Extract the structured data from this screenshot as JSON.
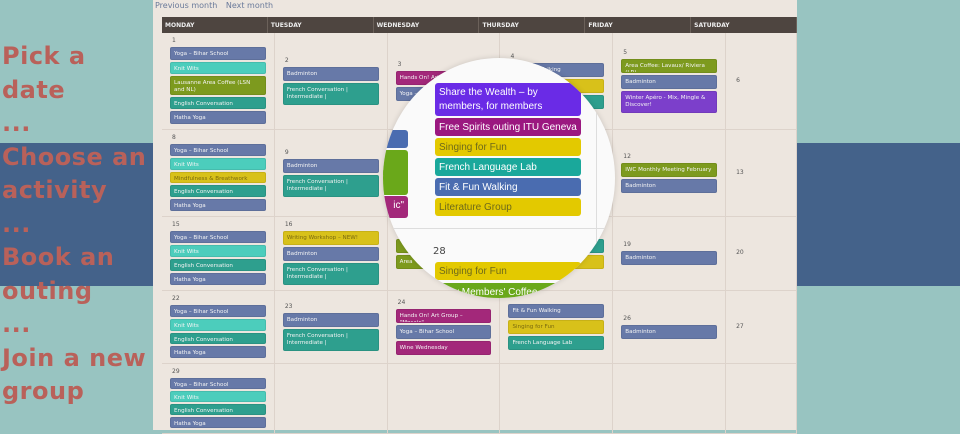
{
  "promo": {
    "lines": [
      "Pick a date",
      "...",
      "Choose an",
      "activity",
      "...",
      "Book an",
      "outing",
      "...",
      "Join a new",
      "group"
    ]
  },
  "nav": {
    "previous": "Previous month",
    "next": "Next month"
  },
  "colors": {
    "slate": "#6779a8",
    "aqua": "#4ccdbc",
    "olive": "#7d9a1e",
    "teal": "#2e9f8e",
    "magenta": "#a3287a",
    "yellow": "#d8c11a",
    "purple": "#7c3fcb",
    "violet": "#6a2be6",
    "plum": "#9b1880",
    "gold": "#e3c900",
    "cyan": "#1aa89b",
    "blue": "#4a6cb0",
    "green": "#6aa81a"
  },
  "days": [
    "MONDAY",
    "TUESDAY",
    "WEDNESDAY",
    "THURSDAY",
    "FRIDAY",
    "SATURDAY"
  ],
  "weeks": [
    [
      {
        "d": "1",
        "ev": [
          [
            "Yoga – Bihar School",
            "slate"
          ],
          [
            "Knit Wits",
            "aqua"
          ],
          [
            "Lausanne Area Coffee (LSN and NL)",
            "olive",
            1
          ],
          [
            "English Conversation",
            "teal"
          ],
          [
            "Hatha Yoga",
            "slate"
          ]
        ]
      },
      {
        "d": "2",
        "ev": [
          [
            "Badminton",
            "slate"
          ],
          [
            "French Conversation | Intermediate |",
            "teal",
            1
          ]
        ]
      },
      {
        "d": "3",
        "ev": [
          [
            "Hands On! Art Group",
            "magenta"
          ],
          [
            "Yoga – Bihar School",
            "slate"
          ]
        ]
      },
      {
        "d": "4",
        "ev": [
          [
            "Fit & Fun Walking",
            "slate"
          ],
          [
            "",
            "yellow"
          ],
          [
            "",
            "teal"
          ]
        ]
      },
      {
        "d": "5",
        "ev": [
          [
            "Area Coffee: Lavaux/ Riviera (LR)",
            "olive"
          ],
          [
            "Badminton",
            "slate"
          ],
          [
            "Winter Apéro - Mix, Mingle & Discover!",
            "purple",
            1
          ]
        ]
      },
      {
        "d": "6",
        "ev": []
      }
    ],
    [
      {
        "d": "8",
        "ev": [
          [
            "Yoga – Bihar School",
            "slate"
          ],
          [
            "Knit Wits",
            "aqua"
          ],
          [
            "Mindfulness & Breathwork",
            "yellow"
          ],
          [
            "English Conversation",
            "teal"
          ],
          [
            "Hatha Yoga",
            "slate"
          ]
        ]
      },
      {
        "d": "9",
        "ev": [
          [
            "Badminton",
            "slate"
          ],
          [
            "French Conversation | Intermediate |",
            "teal",
            1
          ]
        ]
      },
      {
        "d": "",
        "ev": []
      },
      {
        "d": "",
        "ev": []
      },
      {
        "d": "12",
        "ev": [
          [
            "IWC Monthly Meeting February",
            "olive"
          ],
          [
            "Badminton",
            "slate"
          ]
        ]
      },
      {
        "d": "13",
        "ev": []
      }
    ],
    [
      {
        "d": "15",
        "ev": [
          [
            "Yoga – Bihar School",
            "slate"
          ],
          [
            "Knit Wits",
            "aqua"
          ],
          [
            "English Conversation",
            "teal"
          ],
          [
            "Hatha Yoga",
            "slate"
          ]
        ]
      },
      {
        "d": "16",
        "ev": [
          [
            "Writing Workshop – NEW!",
            "yellow"
          ],
          [
            "Badminton",
            "slate"
          ],
          [
            "French Conversation | Intermediate |",
            "teal",
            1
          ]
        ]
      },
      {
        "d": "",
        "ev": [
          [
            "",
            "olive"
          ],
          [
            "Area",
            "olive"
          ]
        ]
      },
      {
        "d": "",
        "ev": [
          [
            "",
            "teal"
          ],
          [
            "",
            "yellow"
          ]
        ]
      },
      {
        "d": "19",
        "ev": [
          [
            "Badminton",
            "slate"
          ]
        ]
      },
      {
        "d": "20",
        "ev": []
      }
    ],
    [
      {
        "d": "22",
        "ev": [
          [
            "Yoga – Bihar School",
            "slate"
          ],
          [
            "Knit Wits",
            "aqua"
          ],
          [
            "English Conversation",
            "teal"
          ],
          [
            "Hatha Yoga",
            "slate"
          ]
        ]
      },
      {
        "d": "23",
        "ev": [
          [
            "Badminton",
            "slate"
          ],
          [
            "French Conversation | Intermediate |",
            "teal",
            1
          ]
        ]
      },
      {
        "d": "24",
        "ev": [
          [
            "Hands On! Art Group – \"Mosaic\"",
            "magenta"
          ],
          [
            "Yoga – Bihar School",
            "slate"
          ],
          [
            "Wine Wednesday",
            "magenta"
          ]
        ]
      },
      {
        "d": "",
        "ev": [
          [
            "Fit & Fun Walking",
            "slate"
          ],
          [
            "Singing for Fun",
            "yellow"
          ],
          [
            "French Language Lab",
            "teal"
          ]
        ]
      },
      {
        "d": "26",
        "ev": [
          [
            "Badminton",
            "slate"
          ]
        ]
      },
      {
        "d": "27",
        "ev": []
      }
    ],
    [
      {
        "d": "29",
        "ev": [
          [
            "Yoga – Bihar School",
            "slate"
          ],
          [
            "Knit Wits",
            "aqua"
          ],
          [
            "English Conversation",
            "teal"
          ],
          [
            "Hatha Yoga",
            "slate"
          ]
        ]
      },
      {
        "d": "",
        "ev": []
      },
      {
        "d": "",
        "ev": []
      },
      {
        "d": "",
        "ev": []
      },
      {
        "d": "",
        "ev": []
      },
      {
        "d": "",
        "ev": []
      }
    ]
  ],
  "magnifier": {
    "events": [
      [
        "Share the Wealth – by members, for members",
        "violet"
      ],
      [
        "Free Spirits outing ITU Geneva",
        "plum"
      ],
      [
        "Singing for Fun",
        "gold"
      ],
      [
        "French Language Lab",
        "cyan"
      ],
      [
        "Fit & Fun Walking",
        "blue"
      ],
      [
        "Literature Group",
        "gold"
      ]
    ],
    "date": "28",
    "events2": [
      [
        "Singing for Fun",
        "gold"
      ],
      [
        "New Members' Coffee",
        "green"
      ]
    ],
    "partial": "ic\""
  }
}
